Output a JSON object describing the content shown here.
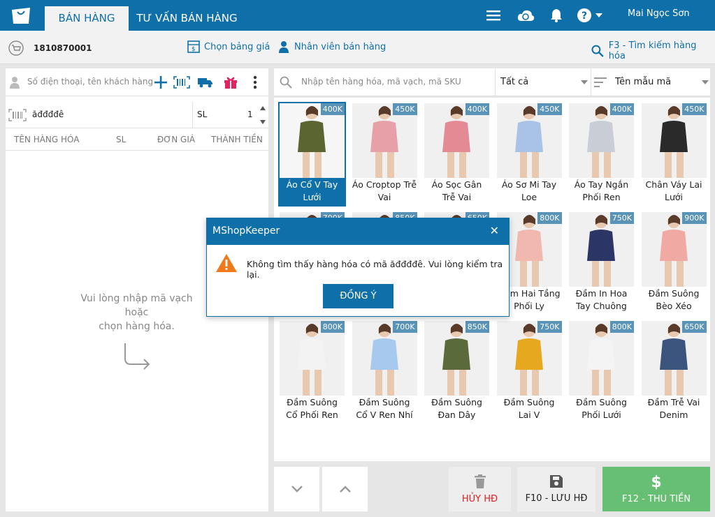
{
  "header": {
    "tabs": [
      {
        "label": "BÁN HÀNG",
        "active": true
      },
      {
        "label": "TƯ VẤN BÁN HÀNG",
        "active": false
      }
    ],
    "user_name": "Mai Ngọc Sơn",
    "icons": [
      "menu-icon",
      "cloud-sync-icon",
      "bell-icon",
      "help-icon",
      "chevron-down-icon"
    ]
  },
  "subbar": {
    "order_number": "1810870001",
    "price_list_label": "Chọn bảng giá",
    "salesperson_label": "Nhân viên bán hàng",
    "search_hint": "F3 - Tìm kiếm hàng hóa"
  },
  "left": {
    "customer_placeholder": "Số điện thoại, tên khách hàng",
    "barcode_value": "ăđđđđê",
    "qty_label": "SL",
    "qty_value": "1",
    "columns": [
      "TÊN HÀNG HÓA",
      "SL",
      "ĐƠN GIÁ",
      "THÀNH TIỀN"
    ],
    "empty_line1": "Vui lòng nhập mã vạch hoặc",
    "empty_line2": "chọn hàng hóa."
  },
  "right": {
    "search_placeholder": "Nhập tên hàng hóa, mã vạch, mã SKU",
    "filter_value": "Tất cả",
    "sort_value": "Tên mẫu mã"
  },
  "products": [
    {
      "name": "Áo Cổ V Tay Lưới",
      "price": "400K",
      "selected": true,
      "color": "#5b6531"
    },
    {
      "name": "Áo Croptop Trễ Vai",
      "price": "450K",
      "color": "#e8a0a8"
    },
    {
      "name": "Áo Sọc Gân Trễ Vai",
      "price": "400K",
      "color": "#e48a95"
    },
    {
      "name": "Áo Sơ Mi Tay Loe",
      "price": "450K",
      "color": "#a9c3e6"
    },
    {
      "name": "Áo Tay Ngắn Phối Ren",
      "price": "400K",
      "color": "#c9ced6"
    },
    {
      "name": "Chân Váy Lai Lưới",
      "price": "450K",
      "color": "#2a2a2a"
    },
    {
      "name": "",
      "price": "700K",
      "color": "#d8c4b6"
    },
    {
      "name": "",
      "price": "850K",
      "color": "#d8c4b6"
    },
    {
      "name": "",
      "price": "650K",
      "color": "#d8c4b6"
    },
    {
      "name": "Đầm Hai Tầng Phối Ly",
      "price": "800K",
      "color": "#f1b8b0"
    },
    {
      "name": "Đầm In Hoa Tay Chuông",
      "price": "750K",
      "color": "#2b3566"
    },
    {
      "name": "Đầm Suông Bèo Xéo",
      "price": "900K",
      "color": "#f1a9a4"
    },
    {
      "name": "Đầm Suông Cổ Phối Ren",
      "price": "800K",
      "color": "#f3f3f3"
    },
    {
      "name": "Đầm Suông Cổ V Ren Nhí",
      "price": "700K",
      "color": "#a8c9ee"
    },
    {
      "name": "Đầm Suông Đan Dây",
      "price": "850K",
      "color": "#5a6a3a"
    },
    {
      "name": "Đầm Suông Lai V",
      "price": "750K",
      "color": "#e6a81f"
    },
    {
      "name": "Đầm Suông Phối Lưới",
      "price": "800K",
      "color": "#f4f4f4"
    },
    {
      "name": "Đầm Trễ Vai Denim",
      "price": "650K",
      "color": "#3b557e"
    }
  ],
  "buttons": {
    "cancel": "HỦY HĐ",
    "save": "F10 - LƯU HĐ",
    "pay": "F12 - THU TIỀN"
  },
  "modal": {
    "title": "MShopKeeper",
    "message": "Không tìm thấy hàng hóa có mã ăđđđđê. Vui lòng kiểm tra lại.",
    "ok_label": "ĐỒNG Ý"
  }
}
